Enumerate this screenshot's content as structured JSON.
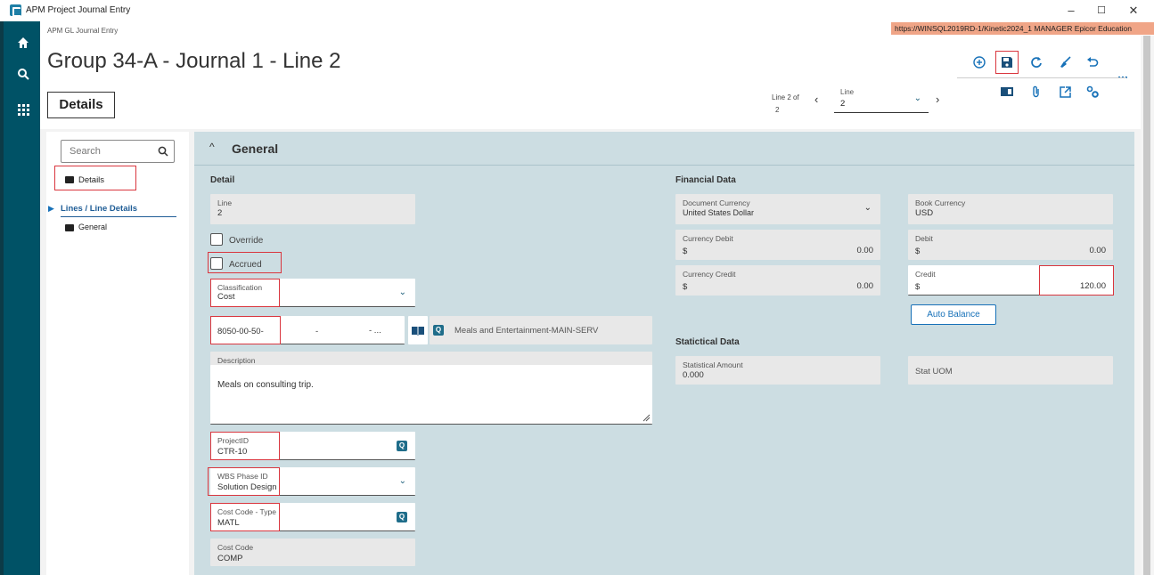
{
  "window": {
    "title": "APM Project Journal Entry",
    "minimize": "–",
    "maximize": "☐",
    "close": "✕"
  },
  "header": {
    "breadcrumb": "APM GL Journal Entry",
    "environment": "https://WINSQL2019RD-1/Kinetic2024_1   MANAGER   Epicor Education",
    "page_title": "Group 34-A - Journal 1 - Line 2",
    "tab": "Details",
    "more": "..."
  },
  "navigator": {
    "count_line1": "Line 2 of",
    "count_line2": "2",
    "select_label": "Line",
    "select_value": "2"
  },
  "sidenav": {
    "search_placeholder": "Search",
    "items": [
      {
        "label": "Details"
      },
      {
        "label": "Lines / Line Details"
      },
      {
        "label": "General"
      }
    ]
  },
  "general": {
    "title": "General",
    "detail_heading": "Detail",
    "line_label": "Line",
    "line_value": "2",
    "override_label": "Override",
    "accrued_label": "Accrued",
    "classification_label": "Classification",
    "classification_value": "Cost",
    "account_value": "8050-00-50-",
    "account_sep1": "-",
    "account_sep2": "- ...",
    "account_desc": "Meals and Entertainment-MAIN-SERV",
    "description_label": "Description",
    "description_value": "Meals on consulting trip.",
    "projectid_label": "ProjectID",
    "projectid_value": "CTR-10",
    "wbs_label": "WBS Phase ID",
    "wbs_value": "Solution Design",
    "costcode_type_label": "Cost Code - Type",
    "costcode_type_value": "MATL",
    "costcode_label": "Cost Code",
    "costcode_value": "COMP"
  },
  "financial": {
    "heading": "Financial Data",
    "doc_currency_label": "Document Currency",
    "doc_currency_value": "United States Dollar",
    "book_currency_label": "Book Currency",
    "book_currency_value": "USD",
    "currency_debit_label": "Currency Debit",
    "currency_debit_symbol": "$",
    "currency_debit_value": "0.00",
    "debit_label": "Debit",
    "debit_symbol": "$",
    "debit_value": "0.00",
    "currency_credit_label": "Currency Credit",
    "currency_credit_symbol": "$",
    "currency_credit_value": "0.00",
    "credit_label": "Credit",
    "credit_symbol": "$",
    "credit_value": "120.00",
    "auto_balance": "Auto Balance"
  },
  "statistical": {
    "heading": "Statictical Data",
    "amount_label": "Statistical Amount",
    "amount_value": "0.000",
    "uom_label": "Stat UOM"
  },
  "colors": {
    "rail": "#005266",
    "accent": "#1771b8",
    "highlight": "#d9363e",
    "panel": "#ccdde2"
  }
}
